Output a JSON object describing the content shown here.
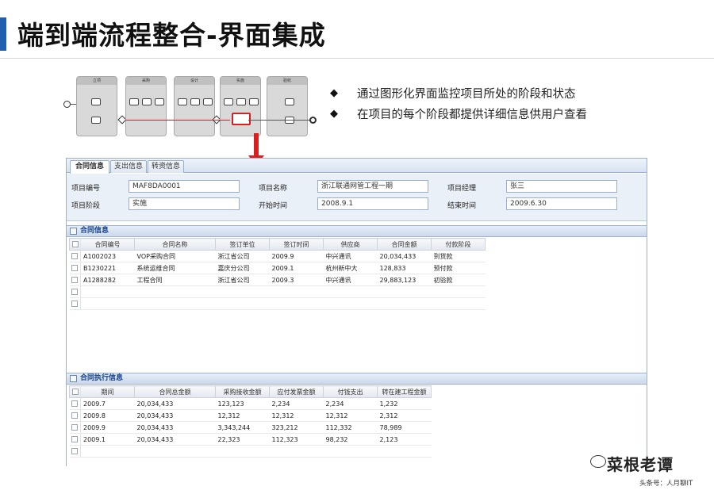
{
  "title": "端到端流程整合-界面集成",
  "bullets": [
    "通过图形化界面监控项目所处的阶段和状态",
    "在项目的每个阶段都提供详细信息供用户查看"
  ],
  "bullet_symbol": "◆",
  "diagram": {
    "lanes": [
      "立项",
      "采购",
      "设计",
      "实施",
      "验收"
    ]
  },
  "window": {
    "tabs": [
      {
        "label": "合同信息",
        "active": true
      },
      {
        "label": "支出信息",
        "active": false
      },
      {
        "label": "转资信息",
        "active": false
      }
    ],
    "form": {
      "project_no_label": "项目编号",
      "project_no_value": "MAF8DA0001",
      "project_name_label": "项目名称",
      "project_name_value": "浙江联通网管工程一期",
      "manager_label": "项目经理",
      "manager_value": "张三",
      "stage_label": "项目阶段",
      "stage_value": "实施",
      "start_label": "开始时间",
      "start_value": "2008.9.1",
      "end_label": "结束时间",
      "end_value": "2009.6.30"
    },
    "contracts": {
      "title": "合同信息",
      "columns": [
        "合同编号",
        "合同名称",
        "签订单位",
        "签订时间",
        "供应商",
        "合同金额",
        "付款阶段"
      ],
      "rows": [
        [
          "A1002023",
          "VOP采购合同",
          "浙江省公司",
          "2009.9",
          "中兴通讯",
          "20,034,433",
          "到货款"
        ],
        [
          "B1230221",
          "系统运维合同",
          "嘉庆分公司",
          "2009.1",
          "杭州新中大",
          "128,833",
          "预付款"
        ],
        [
          "A1288282",
          "工程合同",
          "浙江省公司",
          "2009.3",
          "中兴通讯",
          "29,883,123",
          "初验款"
        ]
      ]
    },
    "execution": {
      "title": "合同执行信息",
      "columns": [
        "期间",
        "合同总金额",
        "采购接收金额",
        "应付发票金额",
        "付钱支出",
        "转在建工程金额"
      ],
      "rows": [
        [
          "2009.7",
          "20,034,433",
          "123,123",
          "2,234",
          "2,234",
          "1,232"
        ],
        [
          "2009.8",
          "20,034,433",
          "12,312",
          "12,312",
          "12,312",
          "2,312"
        ],
        [
          "2009.9",
          "20,034,433",
          "3,343,244",
          "323,212",
          "112,332",
          "78,989"
        ],
        [
          "2009.1",
          "20,034,433",
          "22,323",
          "112,323",
          "98,232",
          "2,123"
        ]
      ]
    }
  },
  "watermark": {
    "name": "菜根老谭",
    "sub": "头条号：人月聊IT"
  },
  "colors": {
    "accent": "#1f5fae",
    "arrow": "#d92020",
    "section_text": "#15428b"
  }
}
